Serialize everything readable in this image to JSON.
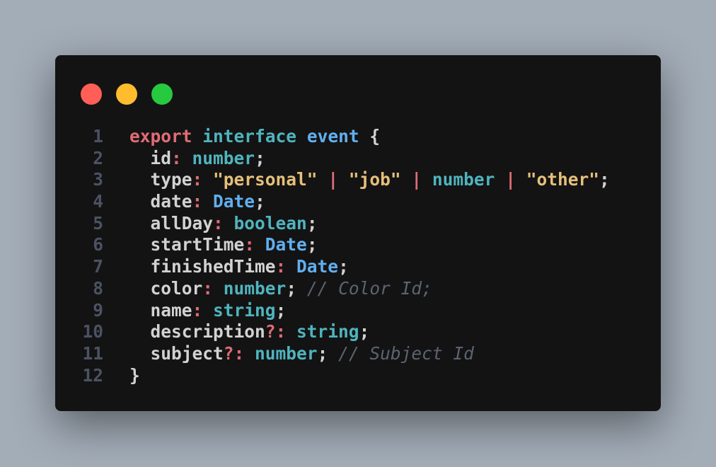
{
  "window": {
    "controls": [
      {
        "name": "close",
        "color": "#ff5f56"
      },
      {
        "name": "minimize",
        "color": "#ffbd2e"
      },
      {
        "name": "maximize",
        "color": "#27c93f"
      }
    ]
  },
  "colors": {
    "keyword": "#e06c75",
    "type": "#4fb4be",
    "class": "#61afef",
    "string": "#e5c07b",
    "text": "#d2d2d2",
    "comment": "#5c6370",
    "line_number": "#4b5263",
    "background": "#131313"
  },
  "code": {
    "lines": [
      {
        "n": "1",
        "tokens": [
          {
            "t": "export",
            "c": "k"
          },
          {
            "t": " ",
            "c": "p"
          },
          {
            "t": "interface",
            "c": "t"
          },
          {
            "t": " ",
            "c": "p"
          },
          {
            "t": "event",
            "c": "b"
          },
          {
            "t": " {",
            "c": "p"
          }
        ]
      },
      {
        "n": "2",
        "tokens": [
          {
            "t": "  id",
            "c": "p"
          },
          {
            "t": ":",
            "c": "o"
          },
          {
            "t": " ",
            "c": "p"
          },
          {
            "t": "number",
            "c": "t"
          },
          {
            "t": ";",
            "c": "p"
          }
        ]
      },
      {
        "n": "3",
        "tokens": [
          {
            "t": "  type",
            "c": "p"
          },
          {
            "t": ":",
            "c": "o"
          },
          {
            "t": " ",
            "c": "p"
          },
          {
            "t": "\"personal\"",
            "c": "s"
          },
          {
            "t": " ",
            "c": "p"
          },
          {
            "t": "|",
            "c": "o"
          },
          {
            "t": " ",
            "c": "p"
          },
          {
            "t": "\"job\"",
            "c": "s"
          },
          {
            "t": " ",
            "c": "p"
          },
          {
            "t": "|",
            "c": "o"
          },
          {
            "t": " ",
            "c": "p"
          },
          {
            "t": "number",
            "c": "t"
          },
          {
            "t": " ",
            "c": "p"
          },
          {
            "t": "|",
            "c": "o"
          },
          {
            "t": " ",
            "c": "p"
          },
          {
            "t": "\"other\"",
            "c": "s"
          },
          {
            "t": ";",
            "c": "p"
          }
        ]
      },
      {
        "n": "4",
        "tokens": [
          {
            "t": "  date",
            "c": "p"
          },
          {
            "t": ":",
            "c": "o"
          },
          {
            "t": " ",
            "c": "p"
          },
          {
            "t": "Date",
            "c": "b"
          },
          {
            "t": ";",
            "c": "p"
          }
        ]
      },
      {
        "n": "5",
        "tokens": [
          {
            "t": "  allDay",
            "c": "p"
          },
          {
            "t": ":",
            "c": "o"
          },
          {
            "t": " ",
            "c": "p"
          },
          {
            "t": "boolean",
            "c": "t"
          },
          {
            "t": ";",
            "c": "p"
          }
        ]
      },
      {
        "n": "6",
        "tokens": [
          {
            "t": "  startTime",
            "c": "p"
          },
          {
            "t": ":",
            "c": "o"
          },
          {
            "t": " ",
            "c": "p"
          },
          {
            "t": "Date",
            "c": "b"
          },
          {
            "t": ";",
            "c": "p"
          }
        ]
      },
      {
        "n": "7",
        "tokens": [
          {
            "t": "  finishedTime",
            "c": "p"
          },
          {
            "t": ":",
            "c": "o"
          },
          {
            "t": " ",
            "c": "p"
          },
          {
            "t": "Date",
            "c": "b"
          },
          {
            "t": ";",
            "c": "p"
          }
        ]
      },
      {
        "n": "8",
        "tokens": [
          {
            "t": "  color",
            "c": "p"
          },
          {
            "t": ":",
            "c": "o"
          },
          {
            "t": " ",
            "c": "p"
          },
          {
            "t": "number",
            "c": "t"
          },
          {
            "t": "; ",
            "c": "p"
          },
          {
            "t": "// Color Id;",
            "c": "c"
          }
        ]
      },
      {
        "n": "9",
        "tokens": [
          {
            "t": "  name",
            "c": "p"
          },
          {
            "t": ":",
            "c": "o"
          },
          {
            "t": " ",
            "c": "p"
          },
          {
            "t": "string",
            "c": "t"
          },
          {
            "t": ";",
            "c": "p"
          }
        ]
      },
      {
        "n": "10",
        "tokens": [
          {
            "t": "  description",
            "c": "p"
          },
          {
            "t": "?:",
            "c": "o"
          },
          {
            "t": " ",
            "c": "p"
          },
          {
            "t": "string",
            "c": "t"
          },
          {
            "t": ";",
            "c": "p"
          }
        ]
      },
      {
        "n": "11",
        "tokens": [
          {
            "t": "  subject",
            "c": "p"
          },
          {
            "t": "?:",
            "c": "o"
          },
          {
            "t": " ",
            "c": "p"
          },
          {
            "t": "number",
            "c": "t"
          },
          {
            "t": "; ",
            "c": "p"
          },
          {
            "t": "// Subject Id",
            "c": "c"
          }
        ]
      },
      {
        "n": "12",
        "tokens": [
          {
            "t": "}",
            "c": "p"
          }
        ]
      }
    ]
  }
}
